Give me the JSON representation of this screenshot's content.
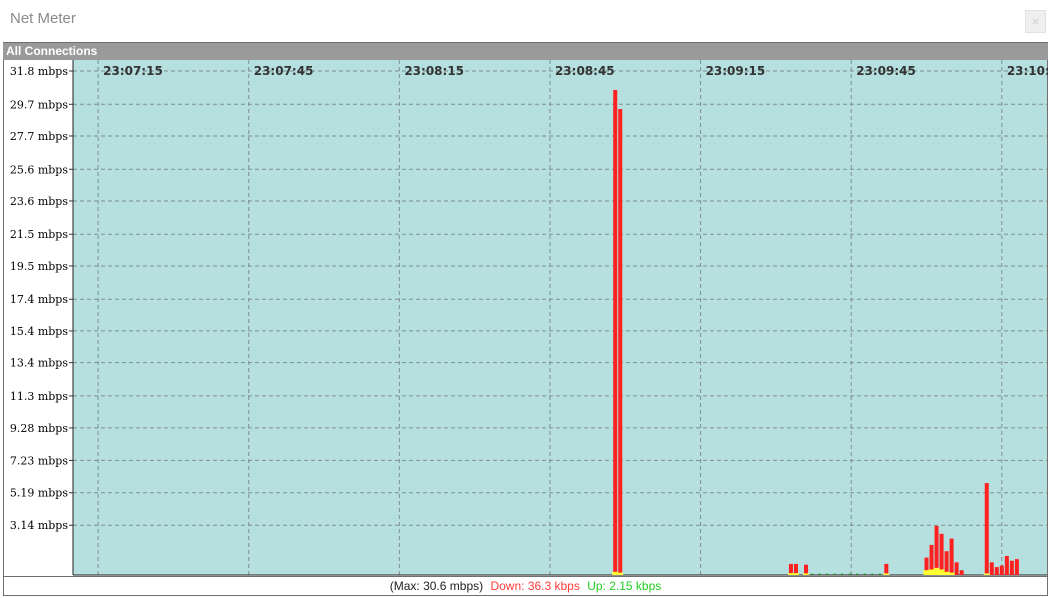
{
  "window": {
    "title": "Net Meter",
    "close_label": "×"
  },
  "panel": {
    "title": "All Connections"
  },
  "status": {
    "max_label": "(Max: 30.6 mbps)",
    "down_label": "Down: 36.3 kbps",
    "up_label": "Up: 2.15 kbps"
  },
  "colors": {
    "plot_background": "#b6dfe0",
    "down": "#ff2020",
    "up": "#ffff33",
    "grid": "#7f8f8f",
    "status_down": "#ff3b3b",
    "status_up": "#22cc22"
  },
  "chart_data": {
    "type": "bar",
    "title": "All Connections",
    "y_axis": {
      "unit": "mbps",
      "ylim": [
        0,
        31.8
      ],
      "ticks": [
        "31.8 mbps",
        "29.7 mbps",
        "27.7 mbps",
        "25.6 mbps",
        "23.6 mbps",
        "21.5 mbps",
        "19.5 mbps",
        "17.4 mbps",
        "15.4 mbps",
        "13.4 mbps",
        "11.3 mbps",
        "9.28 mbps",
        "7.23 mbps",
        "5.19 mbps",
        "3.14 mbps"
      ],
      "tick_values": [
        31.8,
        29.7,
        27.7,
        25.6,
        23.6,
        21.5,
        19.5,
        17.4,
        15.4,
        13.4,
        11.3,
        9.28,
        7.23,
        5.19,
        3.14
      ]
    },
    "x_axis": {
      "ticks": [
        "23:07:15",
        "23:07:45",
        "23:08:15",
        "23:08:45",
        "23:09:15",
        "23:09:45",
        "23:10:"
      ],
      "tick_seconds": [
        0,
        30,
        60,
        90,
        120,
        150,
        180
      ],
      "range_seconds": [
        -5,
        189
      ]
    },
    "grid": true,
    "series": [
      {
        "name": "Down",
        "points": [
          {
            "t": 103,
            "v": 30.6
          },
          {
            "t": 104,
            "v": 29.4
          },
          {
            "t": 138,
            "v": 0.7
          },
          {
            "t": 139,
            "v": 0.7
          },
          {
            "t": 141,
            "v": 0.65
          },
          {
            "t": 157,
            "v": 0.7
          },
          {
            "t": 165,
            "v": 1.1
          },
          {
            "t": 166,
            "v": 1.9
          },
          {
            "t": 167,
            "v": 3.1
          },
          {
            "t": 168,
            "v": 2.6
          },
          {
            "t": 169,
            "v": 1.5
          },
          {
            "t": 170,
            "v": 2.3
          },
          {
            "t": 171,
            "v": 0.8
          },
          {
            "t": 172,
            "v": 0.3
          },
          {
            "t": 177,
            "v": 5.8
          },
          {
            "t": 178,
            "v": 0.8
          },
          {
            "t": 179,
            "v": 0.5
          },
          {
            "t": 180,
            "v": 0.6
          },
          {
            "t": 181,
            "v": 1.2
          },
          {
            "t": 182,
            "v": 0.9
          },
          {
            "t": 183,
            "v": 1.0
          }
        ]
      },
      {
        "name": "Up",
        "points": [
          {
            "t": 103,
            "v": 0.2
          },
          {
            "t": 104,
            "v": 0.15
          },
          {
            "t": 138,
            "v": 0.12
          },
          {
            "t": 139,
            "v": 0.12
          },
          {
            "t": 141,
            "v": 0.1
          },
          {
            "t": 157,
            "v": 0.1
          },
          {
            "t": 165,
            "v": 0.3
          },
          {
            "t": 166,
            "v": 0.35
          },
          {
            "t": 167,
            "v": 0.45
          },
          {
            "t": 168,
            "v": 0.35
          },
          {
            "t": 169,
            "v": 0.2
          },
          {
            "t": 170,
            "v": 0.15
          },
          {
            "t": 177,
            "v": 0.1
          }
        ]
      }
    ]
  }
}
